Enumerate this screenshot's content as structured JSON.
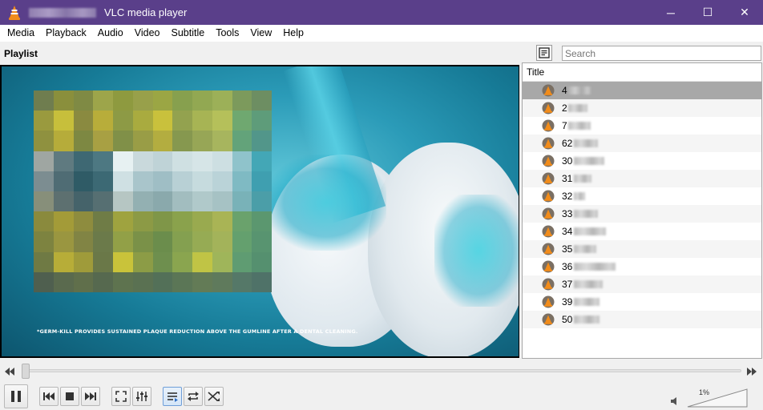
{
  "window": {
    "title": "VLC media player",
    "minimize_icon": "minimize-icon",
    "maximize_icon": "maximize-icon",
    "close_icon": "close-icon",
    "minimize_glyph": "─",
    "maximize_glyph": "☐",
    "close_glyph": "✕",
    "title_bar_color": "#5a3f8a"
  },
  "menu": [
    "Media",
    "Playback",
    "Audio",
    "Video",
    "Subtitle",
    "Tools",
    "View",
    "Help"
  ],
  "playlist": {
    "title": "Playlist",
    "view_icon": "playlist-view-icon",
    "search_placeholder": "Search",
    "column_title": "Title",
    "selected_index": 0,
    "items": [
      {
        "num": "4"
      },
      {
        "num": "2"
      },
      {
        "num": "7"
      },
      {
        "num": "62"
      },
      {
        "num": "30"
      },
      {
        "num": "31"
      },
      {
        "num": "32"
      },
      {
        "num": "33"
      },
      {
        "num": "34"
      },
      {
        "num": "35"
      },
      {
        "num": "36"
      },
      {
        "num": "37"
      },
      {
        "num": "39"
      },
      {
        "num": "50"
      }
    ]
  },
  "video": {
    "disclaimer": "*GERM-KILL PROVIDES SUSTAINED PLAQUE REDUCTION ABOVE THE GUMLINE AFTER A DENTAL CLEANING."
  },
  "seek": {
    "back_icon": "seek-backward-icon",
    "forward_icon": "seek-forward-icon",
    "position": 0.0
  },
  "controls": {
    "pause_icon": "pause-icon",
    "previous_icon": "previous-icon",
    "stop_icon": "stop-icon",
    "next_icon": "next-icon",
    "fullscreen_icon": "fullscreen-icon",
    "extended_settings_icon": "extended-settings-icon",
    "playlist_toggle_icon": "playlist-toggle-icon",
    "loop_icon": "loop-icon",
    "shuffle_icon": "shuffle-icon",
    "volume_icon": "volume-icon",
    "volume_percent": "1%",
    "accent_color": "#2f6fc6"
  }
}
